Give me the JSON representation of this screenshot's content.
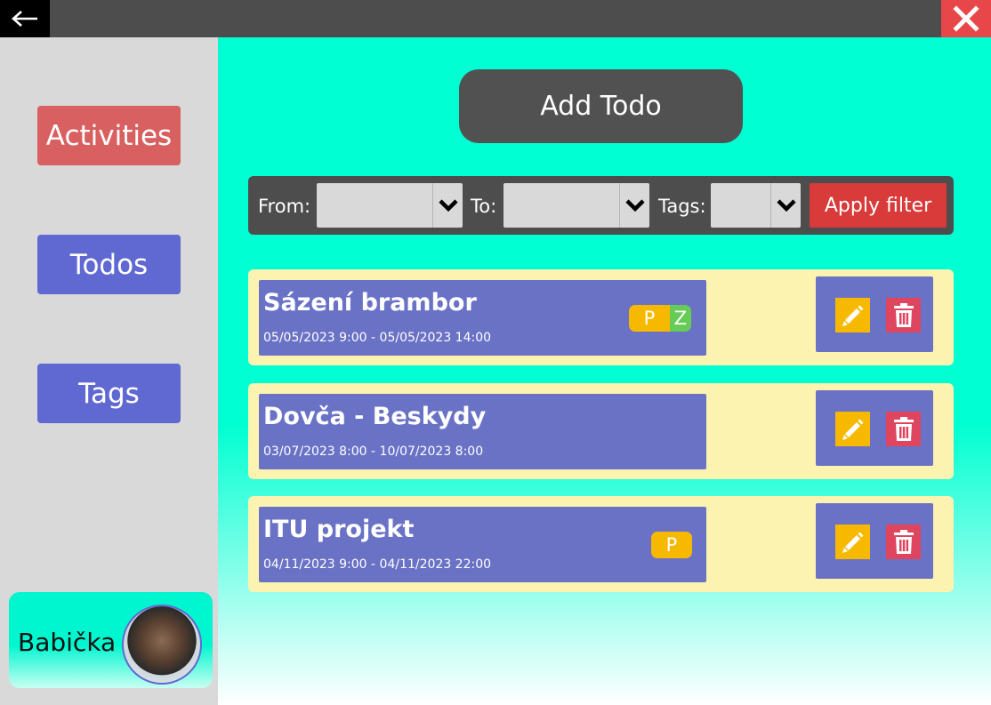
{
  "window": {
    "back_icon": "arrow-left-icon",
    "close_icon": "close-x-icon"
  },
  "sidebar": {
    "items": [
      {
        "label": "Activities",
        "color": "#d96060"
      },
      {
        "label": "Todos",
        "color": "#6068d2"
      },
      {
        "label": "Tags",
        "color": "#6068d2"
      }
    ],
    "user": {
      "name": "Babička"
    }
  },
  "main": {
    "add_button": "Add Todo",
    "filter": {
      "from_label": "From:",
      "from_value": "",
      "to_label": "To:",
      "to_value": "",
      "tags_label": "Tags:",
      "tags_value": "",
      "apply_label": "Apply filter"
    },
    "todos": [
      {
        "title": "Sázení brambor",
        "date": "05/05/2023 9:00 - 05/05/2023 14:00",
        "tags": [
          "P",
          "Z"
        ]
      },
      {
        "title": "Dovča - Beskydy",
        "date": "03/07/2023 8:00 - 10/07/2023 8:00",
        "tags": []
      },
      {
        "title": "ITU projekt",
        "date": "04/11/2023 9:00 - 04/11/2023 22:00",
        "tags": [
          "P"
        ]
      }
    ]
  },
  "colors": {
    "accent": "#00ffd2",
    "primary": "#6068d2",
    "danger": "#d93a3a",
    "tag_p": "#f7b900",
    "tag_z": "#66cc55",
    "row_bg": "#fdf3b0"
  }
}
